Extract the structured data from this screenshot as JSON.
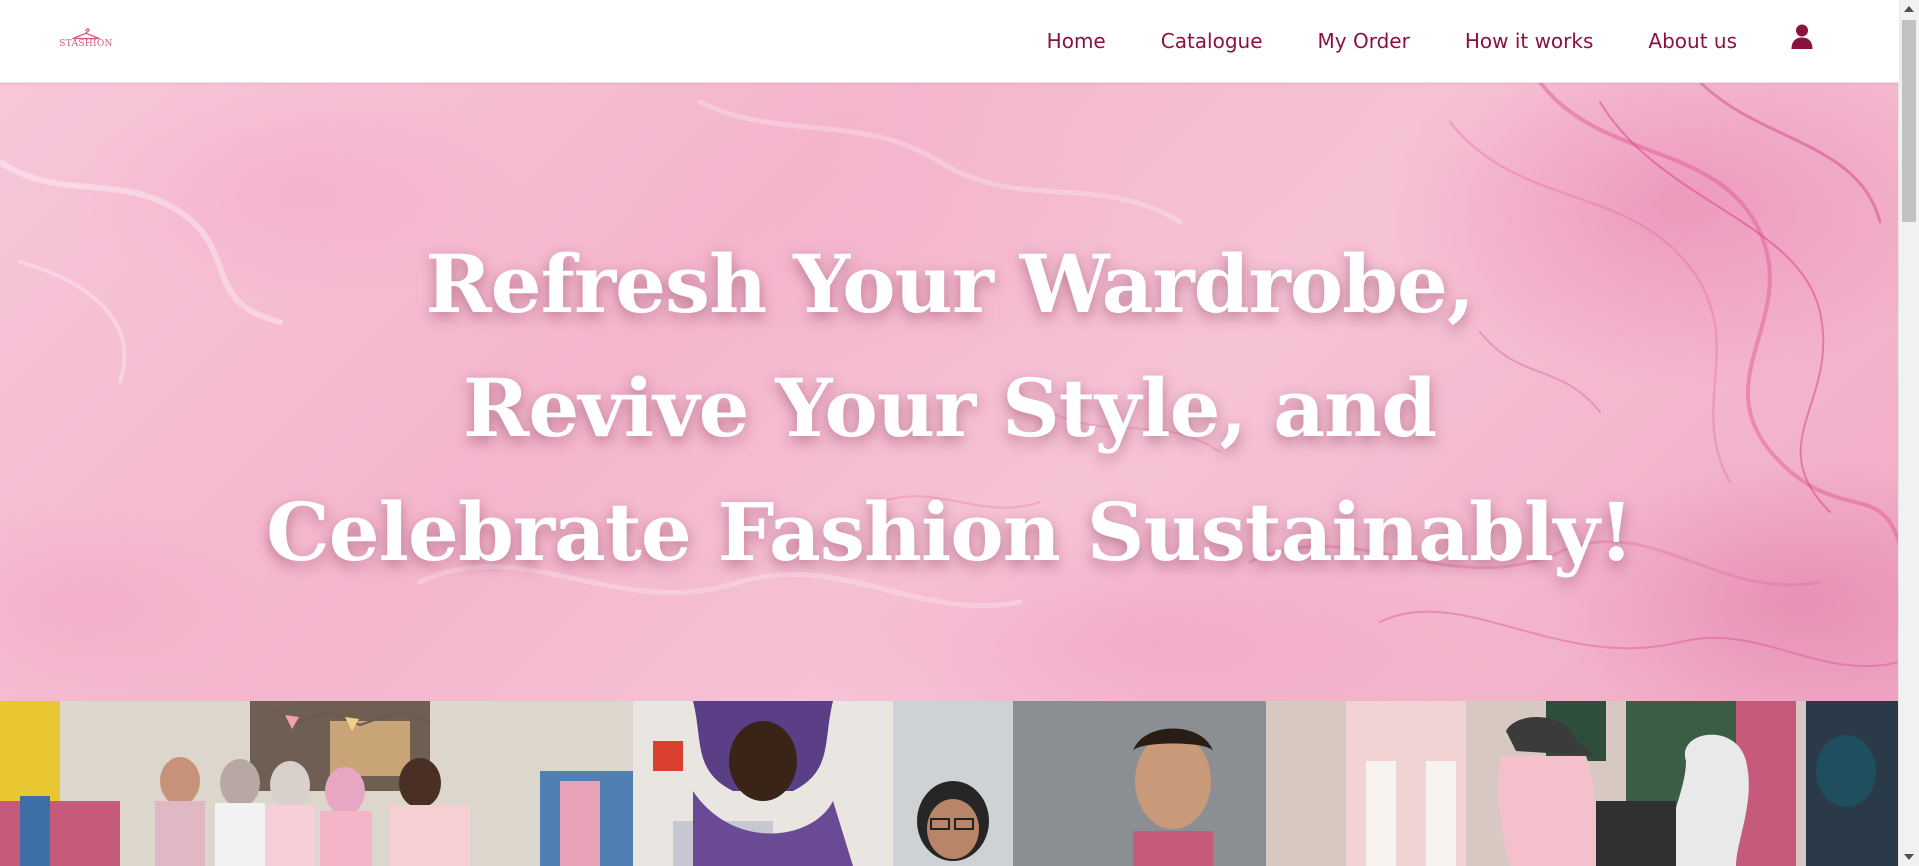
{
  "brand": {
    "logo_text": "STASHION",
    "logo_icon": "hanger-icon",
    "accent_color": "#8a1240",
    "logo_color": "#d9567f"
  },
  "nav": {
    "items": [
      {
        "label": "Home"
      },
      {
        "label": "Catalogue"
      },
      {
        "label": "My Order"
      },
      {
        "label": "How it works"
      },
      {
        "label": "About us"
      }
    ],
    "account_icon": "user-icon"
  },
  "hero": {
    "lines": [
      "Refresh Your Wardrobe,",
      "Revive Your Style, and",
      "Celebrate Fashion Sustainably!"
    ],
    "background": "pink marble texture"
  },
  "photos": [
    {
      "alt": "Volunteers at clothing swap stall"
    },
    {
      "alt": "Smiling participants holding bags"
    },
    {
      "alt": "Group browsing clothes outdoors"
    }
  ],
  "scrollbar": {
    "position_fraction": 0.0
  }
}
